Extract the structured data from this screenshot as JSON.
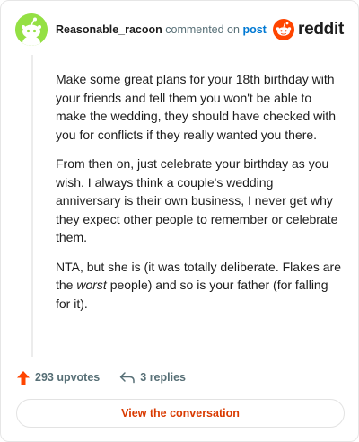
{
  "comment": {
    "username": "Reasonable_racoon",
    "action_text": "commented on",
    "post_link": "post",
    "paragraphs": [
      "Make some great plans for your 18th birthday with your friends and tell them you won't be able to make the wedding, they should have checked with you for conflicts if they really wanted you there.",
      "From then on, just celebrate your birthday as you wish. I always think a couple's wedding anniversary is their own business, I never get why they expect other people to remember or celebrate them."
    ],
    "p3_before": "NTA, but she is (it was totally deliberate. Flakes are the ",
    "p3_italic": "worst",
    "p3_after": " people) and so is your father (for falling for it)."
  },
  "brand": {
    "name": "reddit",
    "color": "#ff4500"
  },
  "actions": {
    "upvotes": "293 upvotes",
    "replies": "3 replies"
  },
  "cta": {
    "label": "View the conversation"
  },
  "icons": {
    "avatar": "snoo-avatar-icon",
    "logo": "reddit-logo-icon",
    "upvote": "upvote-arrow-icon",
    "reply": "reply-arrow-icon"
  }
}
